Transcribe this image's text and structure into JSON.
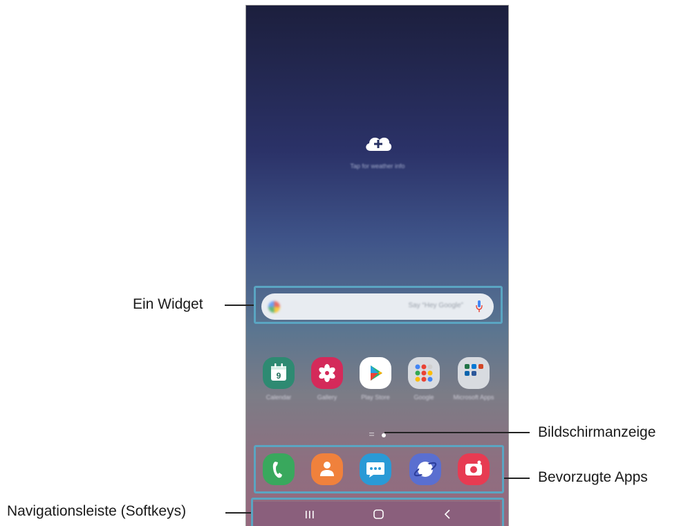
{
  "home_screen": {
    "weather_widget": {
      "icon": "cloud-plus-icon",
      "text": "Tap for weather info"
    },
    "search_widget": {
      "logo": "google-g-icon",
      "placeholder": "Say “Hey Google”",
      "icon": "mic-icon"
    },
    "apps": [
      {
        "label": "Calendar",
        "icon": "calendar-icon",
        "badge": "9",
        "color": "#2e8a72"
      },
      {
        "label": "Gallery",
        "icon": "gallery-flower-icon",
        "color": "#d42a5a"
      },
      {
        "label": "Play Store",
        "icon": "play-store-icon",
        "color": "#ffffff"
      },
      {
        "label": "Google",
        "icon": "folder-icon",
        "color": "#d8dbe0"
      },
      {
        "label": "Microsoft Apps",
        "icon": "folder-icon",
        "color": "#d8dbe0"
      }
    ],
    "page_indicator": {
      "icons": [
        "page-list-icon",
        "home-page-dot-icon"
      ]
    },
    "dock": [
      {
        "label": "Phone",
        "icon": "phone-icon",
        "color": "#39a85d"
      },
      {
        "label": "Contacts",
        "icon": "contacts-icon",
        "color": "#f0813c"
      },
      {
        "label": "Messages",
        "icon": "messages-icon",
        "color": "#2a9ad6"
      },
      {
        "label": "Internet",
        "icon": "internet-icon",
        "color": "#5a6fd0"
      },
      {
        "label": "Camera",
        "icon": "camera-icon",
        "color": "#e73b52"
      }
    ],
    "nav_bar": [
      {
        "action": "recents",
        "icon": "recents-icon"
      },
      {
        "action": "home",
        "icon": "home-icon"
      },
      {
        "action": "back",
        "icon": "back-icon"
      }
    ]
  },
  "callouts": {
    "widget": "Ein Widget",
    "page_indicator": "Bildschirmanzeige",
    "favorite_apps": "Bevorzugte Apps",
    "navigation_bar": "Navigationsleiste (Softkeys)"
  },
  "colors": {
    "highlight": "#5aa5c2",
    "navbar": "#8a5f7c"
  }
}
